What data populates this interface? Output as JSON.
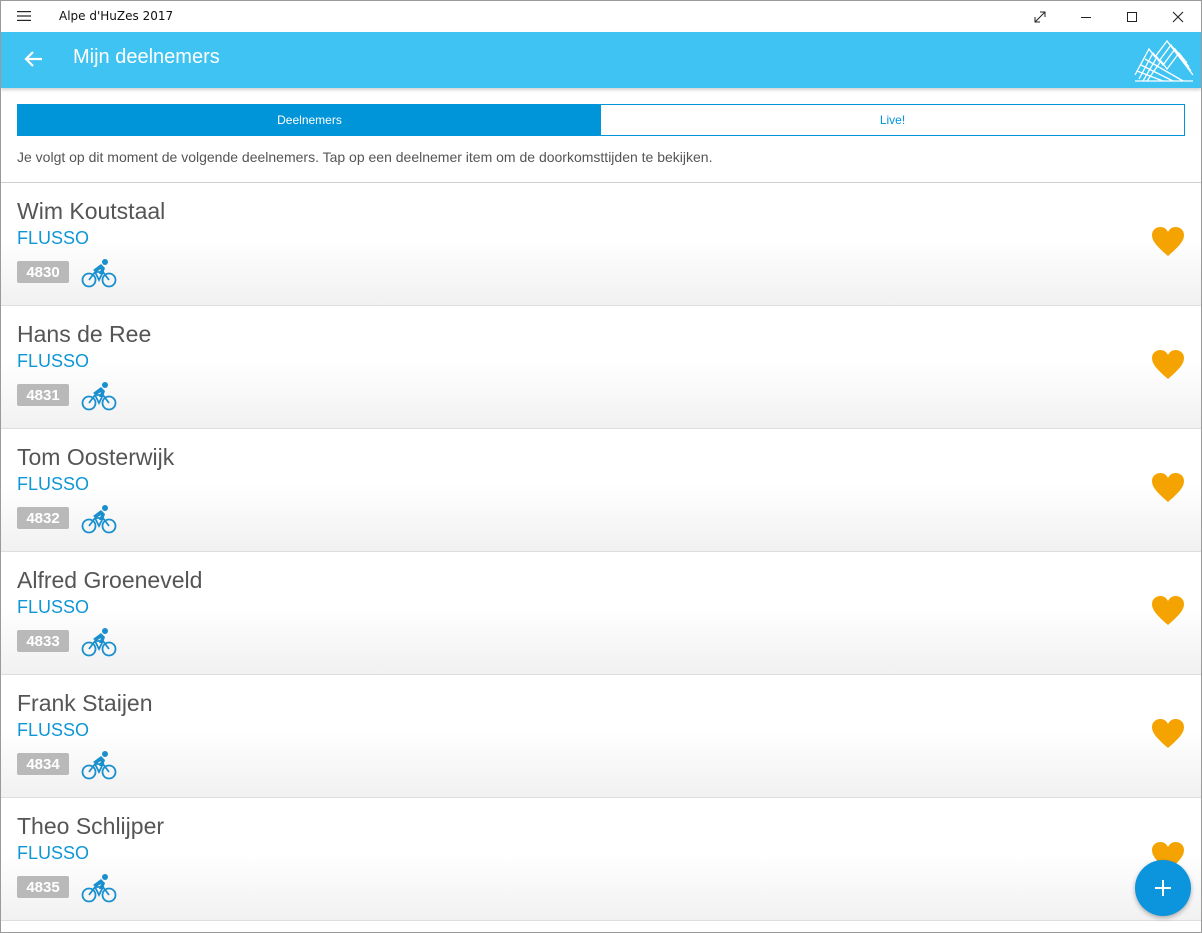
{
  "window": {
    "title": "Alpe d'HuZes 2017"
  },
  "header": {
    "title": "Mijn deelnemers"
  },
  "tabs": [
    {
      "label": "Deelnemers",
      "active": true
    },
    {
      "label": "Live!",
      "active": false
    }
  ],
  "intro_text": "Je volgt op dit moment de volgende deelnemers. Tap op een deelnemer item om de doorkomsttijden te bekijken.",
  "participants": [
    {
      "name": "Wim Koutstaal",
      "team": "FLUSSO",
      "number": "4830",
      "icon": "cyclist-icon",
      "favorite": true
    },
    {
      "name": "Hans de Ree",
      "team": "FLUSSO",
      "number": "4831",
      "icon": "cyclist-icon",
      "favorite": true
    },
    {
      "name": "Tom Oosterwijk",
      "team": "FLUSSO",
      "number": "4832",
      "icon": "cyclist-icon",
      "favorite": true
    },
    {
      "name": "Alfred Groeneveld",
      "team": "FLUSSO",
      "number": "4833",
      "icon": "cyclist-icon",
      "favorite": true
    },
    {
      "name": "Frank Staijen",
      "team": "FLUSSO",
      "number": "4834",
      "icon": "cyclist-icon",
      "favorite": true
    },
    {
      "name": "Theo Schlijper",
      "team": "FLUSSO",
      "number": "4835",
      "icon": "cyclist-icon",
      "favorite": true
    }
  ],
  "colors": {
    "header": "#3ec3f2",
    "accent": "#0094d9",
    "heart": "#f5a300",
    "badge": "#b9b9b9"
  },
  "icons": {
    "fab": "plus-icon",
    "back": "arrow-left-icon",
    "logo": "mountain-logo-icon"
  }
}
